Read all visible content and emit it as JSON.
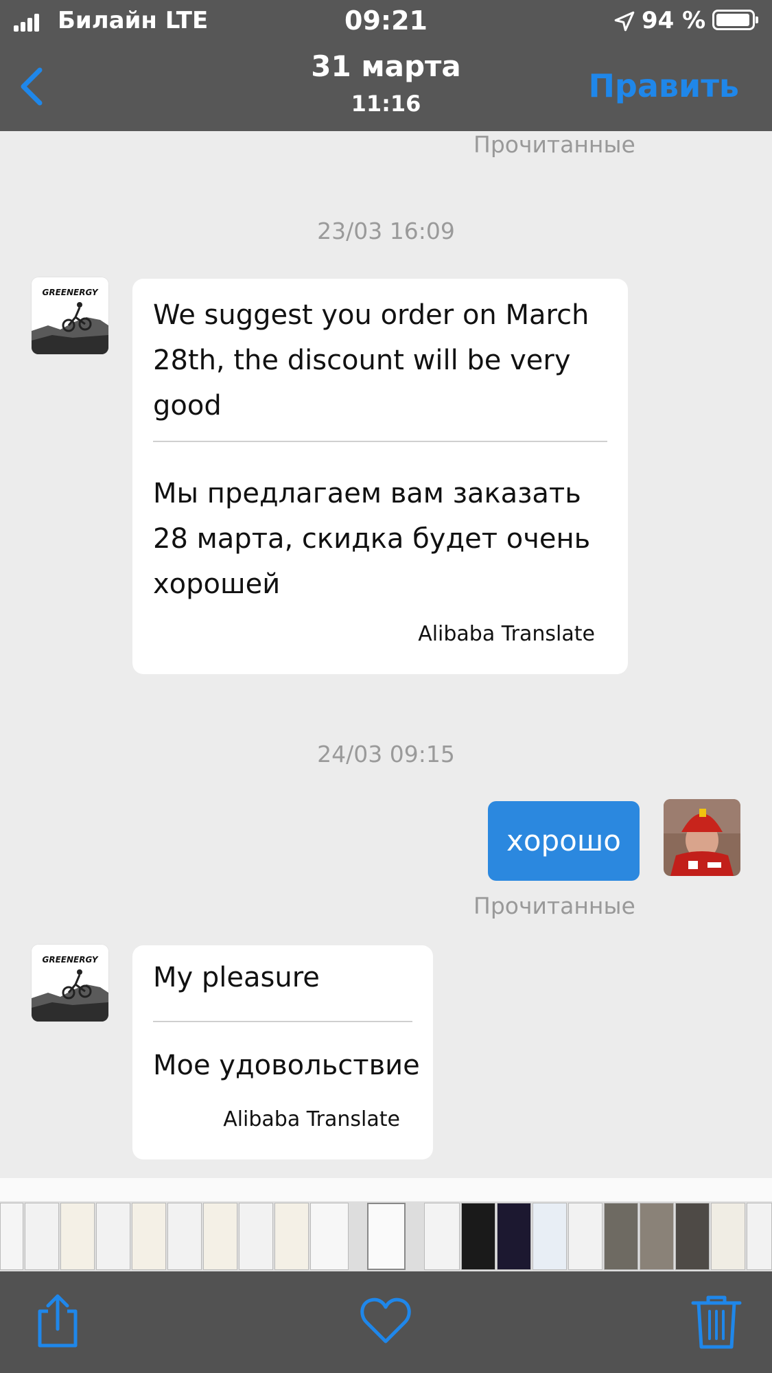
{
  "status_bar": {
    "carrier": "Билайн  LTE",
    "time": "09:21",
    "battery": "94 %"
  },
  "nav": {
    "title": "31 марта",
    "subtitle": "11:16",
    "edit_label": "Править"
  },
  "messages": {
    "read_top": "Прочитанные",
    "stamp1": "23/03 16:09",
    "msg1": {
      "original": "We suggest you order on March 28th, the discount will be very good",
      "translation": "Мы предлагаем вам заказать 28 марта, скидка будет очень хорошей",
      "credit": "Alibaba Translate"
    },
    "stamp2": "24/03 09:15",
    "reply": "хорошо",
    "read_reply": "Прочитанные",
    "msg2": {
      "original": "My pleasure",
      "translation": "Мое удовольствие",
      "credit": "Alibaba Translate"
    },
    "avatar_brand": "GREENERGY"
  },
  "toolbar": {
    "icons": [
      "share-icon",
      "heart-icon",
      "trash-icon"
    ]
  },
  "colors": {
    "accent": "#1f87ea",
    "bar": "#575757",
    "bubble_out": "#2b88df"
  }
}
